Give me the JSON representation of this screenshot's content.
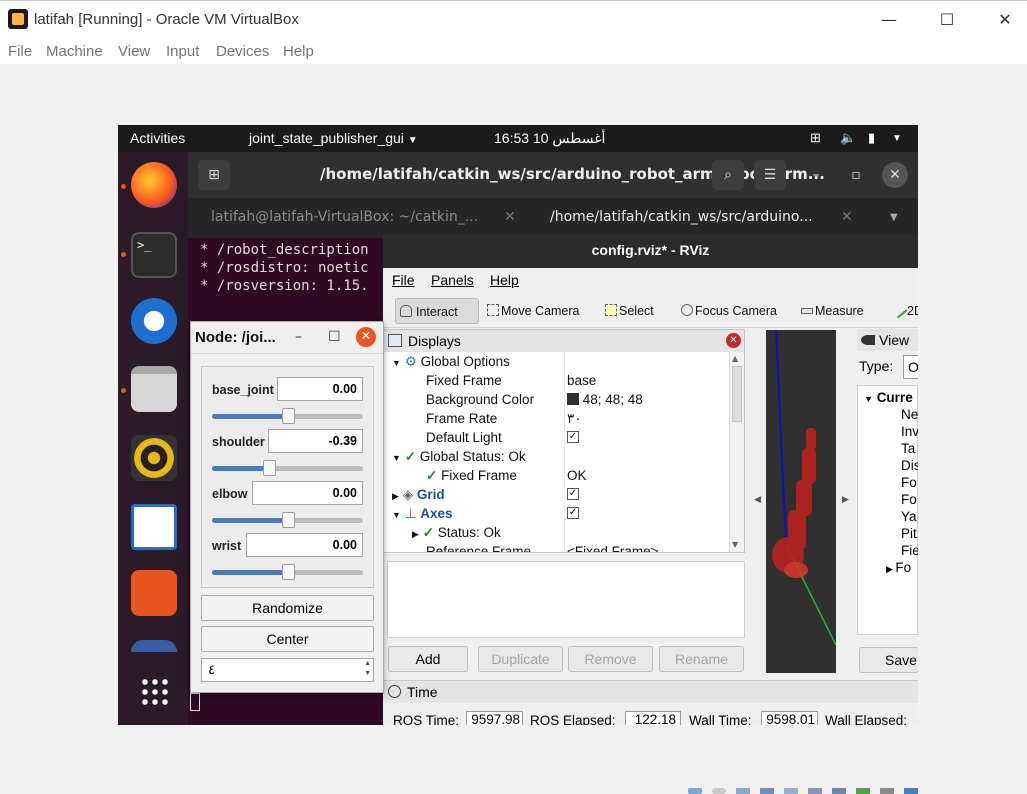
{
  "host": {
    "title": "latifah [Running] - Oracle VM VirtualBox",
    "menu": [
      "File",
      "Machine",
      "View",
      "Input",
      "Devices",
      "Help"
    ],
    "controls": {
      "minimize": "—",
      "maximize": "☐",
      "close": "✕"
    }
  },
  "topbar": {
    "activities": "Activities",
    "app_menu": "joint_state_publisher_gui",
    "clock": "16:53  10 أغسطس"
  },
  "dock": {
    "apps": [
      "firefox-icon",
      "terminal-icon",
      "thunderbird-icon",
      "files-icon",
      "rhythmbox-icon",
      "writer-icon",
      "app-center-icon",
      "show-apps-icon"
    ],
    "terminal_glyph": ">_"
  },
  "terminal": {
    "header_path": "/home/latifah/catkin_ws/src/arduino_robot_arm/robot_arm...",
    "tab1": "latifah@latifah-VirtualBox: ~/catkin_...",
    "tab2": "/home/latifah/catkin_ws/src/arduino...",
    "lines": [
      " * /robot_description",
      " * /rosdistro: noetic",
      " * /rosversion: 1.15."
    ]
  },
  "rviz": {
    "title": "config.rviz* - RViz",
    "menu": {
      "file": "File",
      "panels": "Panels",
      "help": "Help"
    },
    "tools": {
      "interact": "Interact",
      "move_camera": "Move Camera",
      "select": "Select",
      "focus_camera": "Focus Camera",
      "measure": "Measure",
      "pose": "2D"
    },
    "displays": {
      "header": "Displays",
      "rows": {
        "global_options": "Global Options",
        "fixed_frame": "Fixed Frame",
        "fixed_frame_val": "base",
        "background_color": "Background Color",
        "background_color_val": "48; 48; 48",
        "frame_rate": "Frame Rate",
        "frame_rate_val": "٣٠",
        "default_light": "Default Light",
        "global_status": "Global Status: Ok",
        "fixed_frame_status": "Fixed Frame",
        "fixed_frame_status_val": "OK",
        "grid": "Grid",
        "axes": "Axes",
        "axes_status": "Status: Ok",
        "reference_frame": "Reference Frame",
        "reference_frame_val": "<Fixed Frame>"
      }
    },
    "buttons": {
      "add": "Add",
      "duplicate": "Duplicate",
      "remove": "Remove",
      "rename": "Rename"
    },
    "views": {
      "header": "View",
      "type_label": "Type:",
      "type_val": "O",
      "current": "Curre",
      "items": [
        "Ne",
        "Inv",
        "Ta",
        "Dis",
        "Fo",
        "Fo",
        "Ya",
        "Pit",
        "Fie",
        "Fo"
      ],
      "save": "Save"
    },
    "time": {
      "header": "Time",
      "ros_time_label": "ROS Time:",
      "ros_time_val": "9597.98",
      "ros_elapsed_label": "ROS Elapsed:",
      "ros_elapsed_val": "122.18",
      "wall_time_label": "Wall Time:",
      "wall_time_val": "9598.01",
      "wall_elapsed_label": "Wall Elapsed:"
    }
  },
  "jsp": {
    "title": "Node: /joi...",
    "joints": [
      {
        "name": "base_joint",
        "value": "0.00",
        "level": 0.5
      },
      {
        "name": "shoulder",
        "value": "-0.39",
        "level": 0.38
      },
      {
        "name": "elbow",
        "value": "0.00",
        "level": 0.5
      },
      {
        "name": "wrist",
        "value": "0.00",
        "level": 0.5
      }
    ],
    "randomize": "Randomize",
    "center": "Center",
    "spin_value": "٤"
  },
  "colors": {
    "ubuntu_orange": "#e95420",
    "terminal_bg": "#300a24",
    "rviz_bg": "#303030",
    "slider_blue": "#4a7cc0"
  }
}
